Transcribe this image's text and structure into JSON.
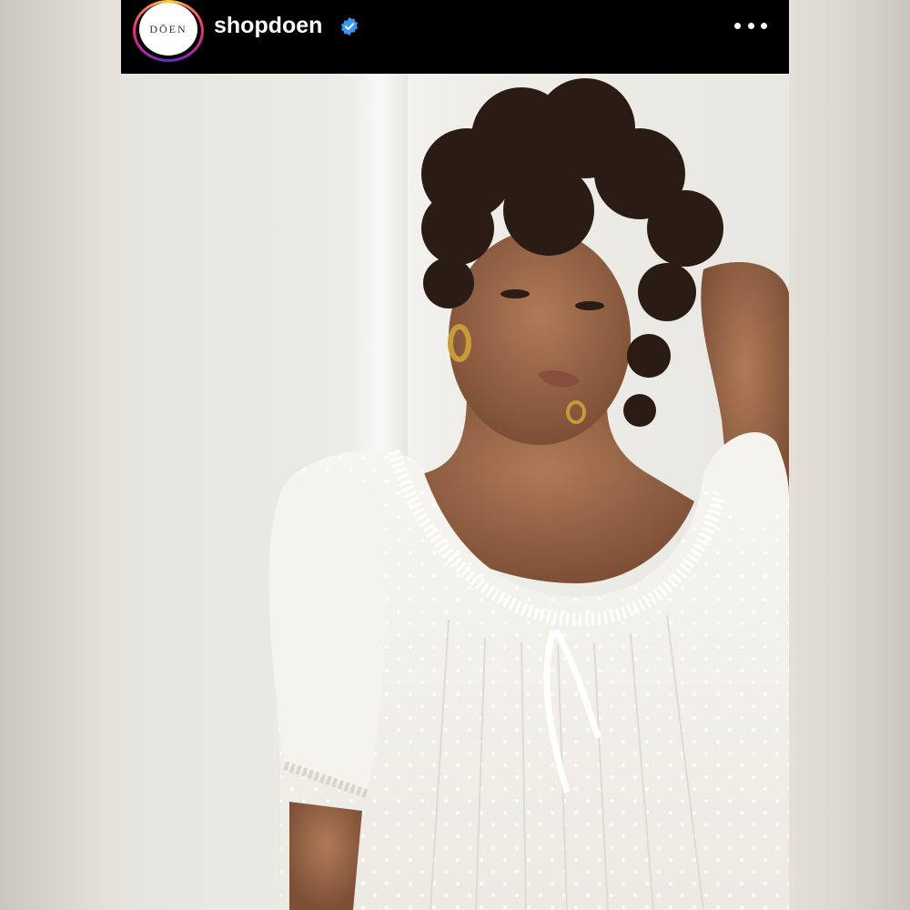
{
  "post": {
    "account": {
      "username": "shopdoen",
      "avatar_text": "DŌEN",
      "verified_icon": "verified-badge-icon",
      "more_icon": "more-options-icon"
    },
    "photo": {
      "description_icon": "fashion-photo"
    },
    "colors": {
      "header_bg": "#000000",
      "verified_blue": "#3897f0",
      "story_ring": "#ee2a7b"
    }
  }
}
